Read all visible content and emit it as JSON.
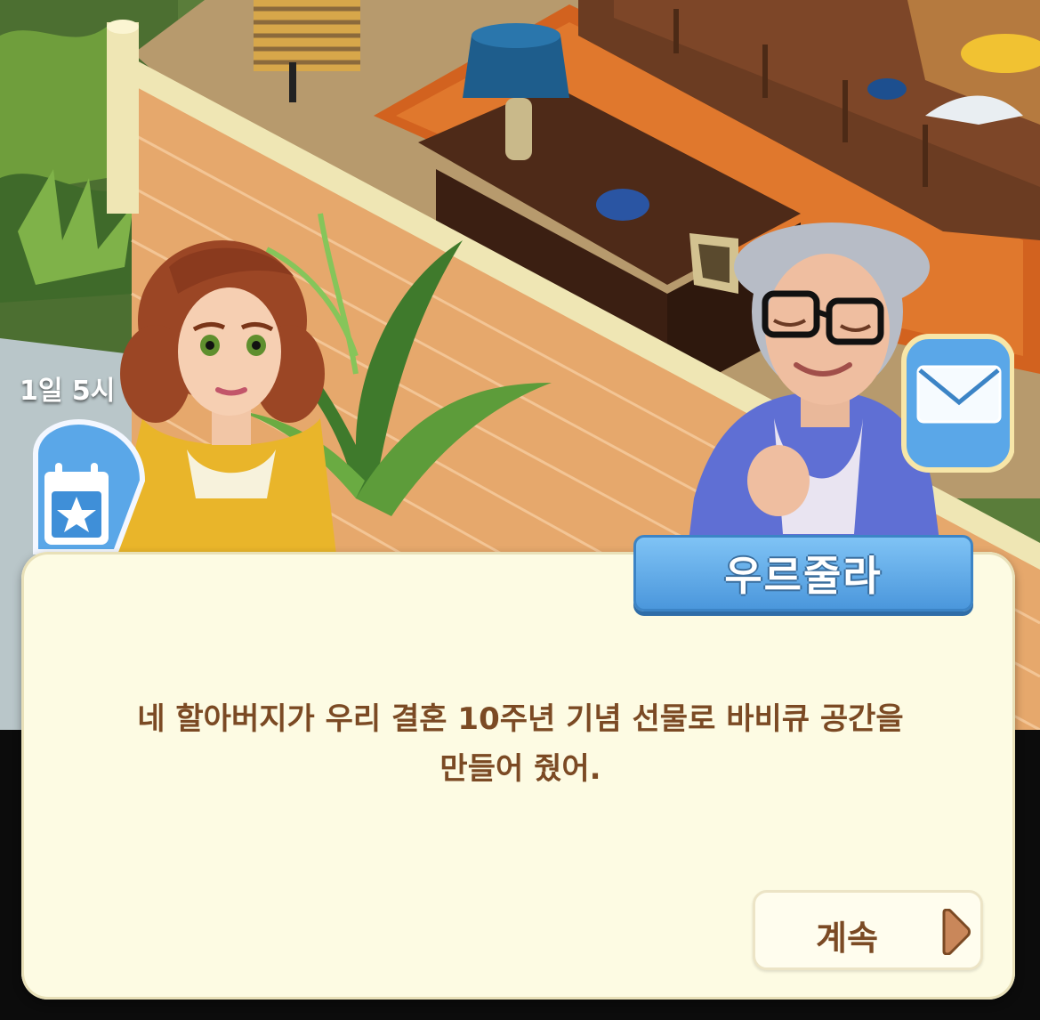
{
  "hud": {
    "timer_text": "1일 5시",
    "event_icon": "calendar-star-icon",
    "mail_icon": "mail-icon"
  },
  "dialog": {
    "speaker_name": "우르줄라",
    "line1": "네 할아버지가 우리 결혼 10주년 기념 선물로 바비큐 공간을",
    "line2": "만들어 줬어.",
    "continue_label": "계속",
    "continue_icon": "play-arrow-icon"
  },
  "colors": {
    "dialog_bg": "#fdfbe3",
    "dialog_text": "#7b4a24",
    "name_tag": "#4b97dc"
  }
}
